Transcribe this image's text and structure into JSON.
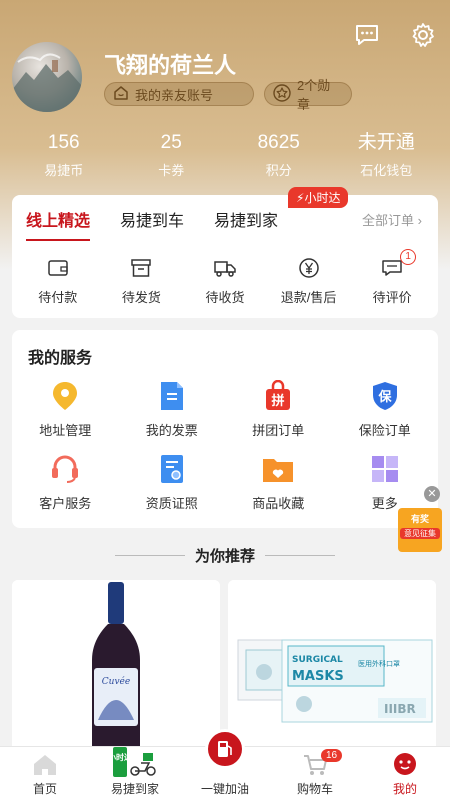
{
  "profile": {
    "username": "飞翔的荷兰人",
    "family_account_label": "我的亲友账号",
    "medals_label": "2个勋章"
  },
  "stats": [
    {
      "value": "156",
      "label": "易捷币"
    },
    {
      "value": "25",
      "label": "卡券"
    },
    {
      "value": "8625",
      "label": "积分"
    },
    {
      "value": "未开通",
      "label": "石化钱包"
    }
  ],
  "orders": {
    "tabs": [
      "线上精选",
      "易捷到车",
      "易捷到家"
    ],
    "flash_badge": "小时达",
    "all_orders_label": "全部订单",
    "items": [
      {
        "label": "待付款",
        "icon": "wallet-icon"
      },
      {
        "label": "待发货",
        "icon": "box-icon"
      },
      {
        "label": "待收货",
        "icon": "truck-icon"
      },
      {
        "label": "退款/售后",
        "icon": "yen-icon"
      },
      {
        "label": "待评价",
        "icon": "comment-icon",
        "count": "1"
      }
    ]
  },
  "services": {
    "title": "我的服务",
    "items": [
      {
        "label": "地址管理",
        "icon": "location-icon",
        "icon_text": ""
      },
      {
        "label": "我的发票",
        "icon": "invoice-icon",
        "icon_text": ""
      },
      {
        "label": "拼团订单",
        "icon": "group-buy-icon",
        "icon_text": "拼"
      },
      {
        "label": "保险订单",
        "icon": "insurance-icon",
        "icon_text": "保"
      },
      {
        "label": "客户服务",
        "icon": "headset-icon",
        "icon_text": ""
      },
      {
        "label": "资质证照",
        "icon": "certificate-icon",
        "icon_text": ""
      },
      {
        "label": "商品收藏",
        "icon": "favorite-folder-icon",
        "icon_text": ""
      },
      {
        "label": "更多",
        "icon": "grid-icon",
        "icon_text": ""
      }
    ]
  },
  "promo": {
    "line1": "有奖",
    "line2": "意见征集"
  },
  "recommend": {
    "title": "为你推荐"
  },
  "products": [
    {
      "name": "wine-bottle-image",
      "label_text": "Cuvée"
    },
    {
      "name": "surgical-masks-image",
      "brand_text": "SURGICAL",
      "text2": "MASKS",
      "text3": "医用外科口罩",
      "code_text": "IIIBR"
    }
  ],
  "tabbar": {
    "items": [
      {
        "label": "首页",
        "icon": "home-icon"
      },
      {
        "label": "易捷到家",
        "icon": "delivery-icon",
        "icon_text": "小时达"
      },
      {
        "label": "一键加油",
        "icon": "fuel-icon"
      },
      {
        "label": "购物车",
        "icon": "cart-icon",
        "badge": "16"
      },
      {
        "label": "我的",
        "icon": "profile-icon"
      }
    ]
  },
  "colors": {
    "accent": "#c8161d",
    "gold": "#c9a774",
    "badge_red": "#e9382b"
  }
}
